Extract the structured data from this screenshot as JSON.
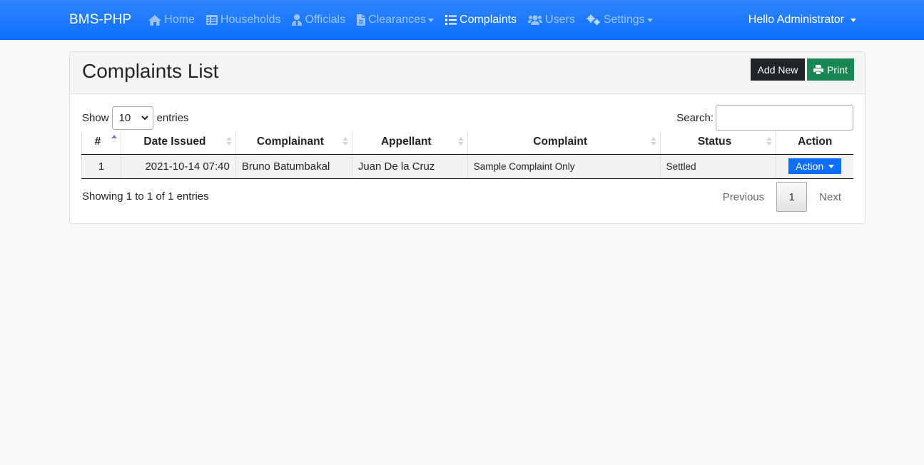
{
  "navbar": {
    "brand": "BMS-PHP",
    "items": [
      {
        "label": "Home",
        "icon": "home-icon",
        "active": false,
        "dropdown": false
      },
      {
        "label": "Households",
        "icon": "table-icon",
        "active": false,
        "dropdown": false
      },
      {
        "label": "Officials",
        "icon": "user-tie-icon",
        "active": false,
        "dropdown": false
      },
      {
        "label": "Clearances",
        "icon": "file-icon",
        "active": false,
        "dropdown": true
      },
      {
        "label": "Complaints",
        "icon": "list-icon",
        "active": true,
        "dropdown": false
      },
      {
        "label": "Users",
        "icon": "users-icon",
        "active": false,
        "dropdown": false
      },
      {
        "label": "Settings",
        "icon": "cogs-icon",
        "active": false,
        "dropdown": true
      }
    ],
    "user_greeting": "Hello Administrator"
  },
  "page": {
    "title": "Complaints List",
    "add_new_label": "Add New",
    "print_label": "Print"
  },
  "table_controls": {
    "show_label": "Show",
    "entries_label": "entries",
    "page_length": "10",
    "search_label": "Search:",
    "search_value": ""
  },
  "table": {
    "columns": [
      "#",
      "Date Issued",
      "Complainant",
      "Appellant",
      "Complaint",
      "Status",
      "Action"
    ],
    "rows": [
      {
        "num": "1",
        "date_issued": "2021-10-14 07:40",
        "complainant": "Bruno Batumbakal",
        "appellant": "Juan De la Cruz",
        "complaint": "Sample Complaint Only",
        "status": "Settled",
        "action_label": "Action"
      }
    ]
  },
  "footer": {
    "info": "Showing 1 to 1 of 1 entries",
    "previous_label": "Previous",
    "current_page": "1",
    "next_label": "Next"
  },
  "colors": {
    "navbar": "#0d6efd",
    "add_new": "#212529",
    "print": "#198754",
    "action": "#0d6efd"
  }
}
